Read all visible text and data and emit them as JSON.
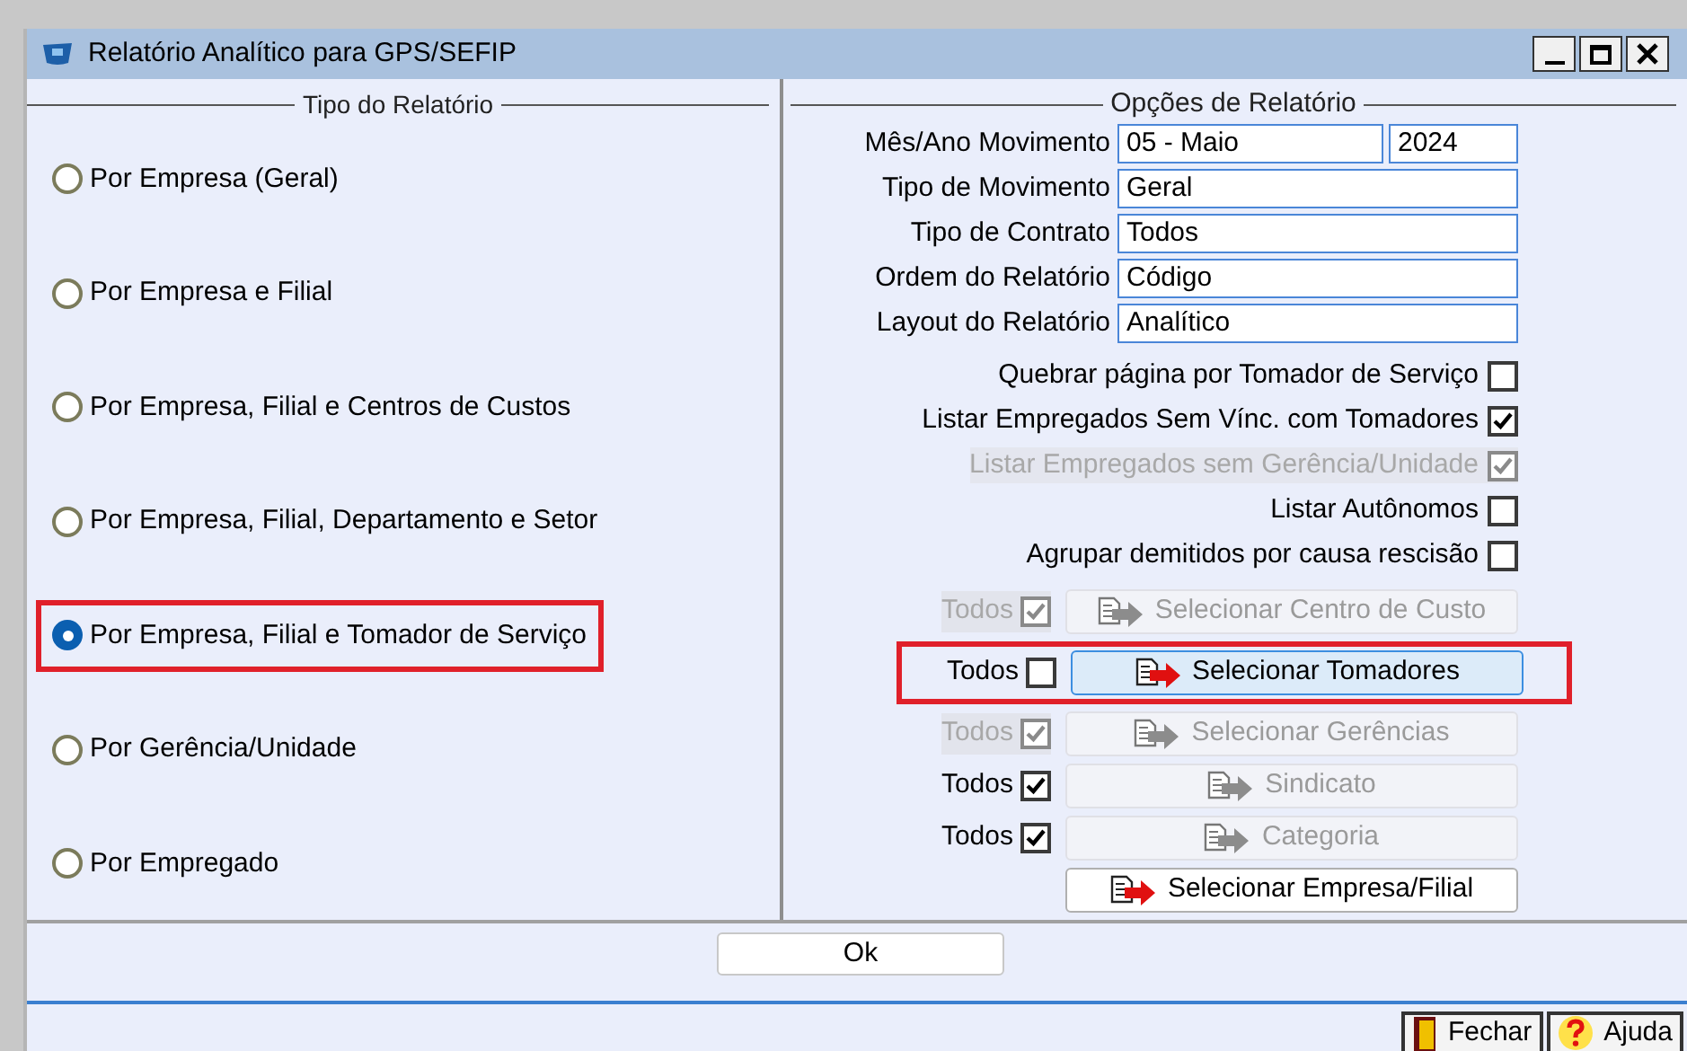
{
  "window": {
    "title": "Relatório Analítico para GPS/SEFIP"
  },
  "left_panel": {
    "title": "Tipo do Relatório",
    "options": [
      {
        "label": "Por Empresa (Geral)",
        "selected": false,
        "highlighted": false
      },
      {
        "label": "Por Empresa e Filial",
        "selected": false,
        "highlighted": false
      },
      {
        "label": "Por Empresa, Filial e Centros de Custos",
        "selected": false,
        "highlighted": false
      },
      {
        "label": "Por Empresa, Filial, Departamento e Setor",
        "selected": false,
        "highlighted": false
      },
      {
        "label": "Por Empresa, Filial e Tomador de Serviço",
        "selected": true,
        "highlighted": true
      },
      {
        "label": "Por Gerência/Unidade",
        "selected": false,
        "highlighted": false
      },
      {
        "label": "Por Empregado",
        "selected": false,
        "highlighted": false
      }
    ]
  },
  "right_panel": {
    "title": "Opções de Relatório",
    "fields": [
      {
        "label": "Mês/Ano Movimento",
        "values": [
          "05 - Maio",
          "2024"
        ]
      },
      {
        "label": "Tipo de Movimento",
        "values": [
          "Geral"
        ]
      },
      {
        "label": "Tipo de Contrato",
        "values": [
          "Todos"
        ]
      },
      {
        "label": "Ordem do Relatório",
        "values": [
          "Código"
        ]
      },
      {
        "label": "Layout do Relatório",
        "values": [
          "Analítico"
        ]
      }
    ],
    "checkboxes": [
      {
        "label": "Quebrar página por Tomador de Serviço",
        "checked": false,
        "disabled": false
      },
      {
        "label": "Listar Empregados Sem Vínc. com Tomadores",
        "checked": true,
        "disabled": false
      },
      {
        "label": "Listar Empregados sem Gerência/Unidade",
        "checked": true,
        "disabled": true
      },
      {
        "label": "Listar Autônomos",
        "checked": false,
        "disabled": false
      },
      {
        "label": "Agrupar demitidos por causa rescisão",
        "checked": false,
        "disabled": false
      }
    ],
    "selectors": [
      {
        "todos": {
          "label": "Todos",
          "checked": true,
          "disabled": true
        },
        "button": "Selecionar Centro de Custo",
        "enabled": false,
        "focused": false,
        "highlighted": false
      },
      {
        "todos": {
          "label": "Todos",
          "checked": false,
          "disabled": false
        },
        "button": "Selecionar Tomadores",
        "enabled": true,
        "focused": true,
        "highlighted": true
      },
      {
        "todos": {
          "label": "Todos",
          "checked": true,
          "disabled": true
        },
        "button": "Selecionar Gerências",
        "enabled": false,
        "focused": false,
        "highlighted": false
      },
      {
        "todos": {
          "label": "Todos",
          "checked": true,
          "disabled": false
        },
        "button": "Sindicato",
        "enabled": false,
        "focused": false,
        "highlighted": false
      },
      {
        "todos": {
          "label": "Todos",
          "checked": true,
          "disabled": false
        },
        "button": "Categoria",
        "enabled": false,
        "focused": false,
        "highlighted": false
      },
      {
        "button": "Selecionar Empresa/Filial",
        "enabled": true,
        "focused": false,
        "highlighted": false
      }
    ]
  },
  "ok_button": "Ok",
  "bottom_buttons": [
    {
      "kind": "close",
      "label": "Fechar"
    },
    {
      "kind": "help",
      "label": "Ajuda"
    }
  ]
}
